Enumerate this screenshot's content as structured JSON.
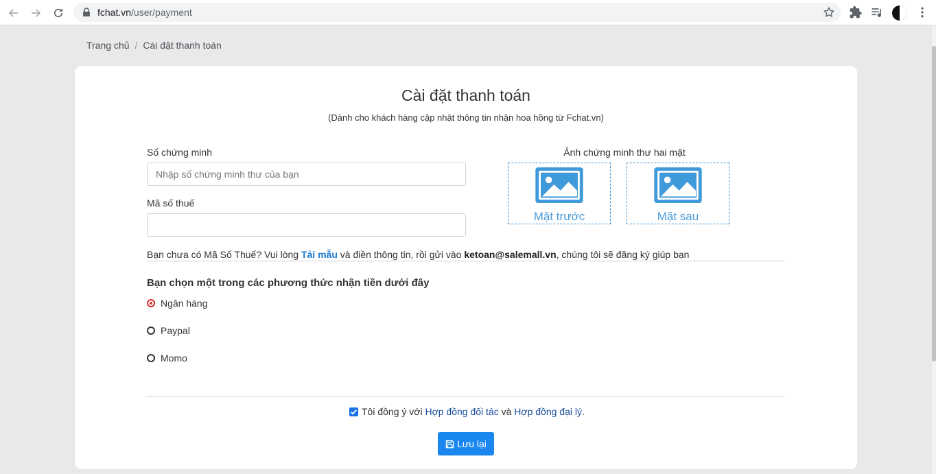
{
  "browser": {
    "url_host": "fchat.vn",
    "url_path": "/user/payment"
  },
  "breadcrumb": {
    "home": "Trang chủ",
    "separator": "/",
    "current": "Cài đặt thanh toán"
  },
  "page": {
    "title": "Cài đặt thanh toán",
    "subtitle": "(Dành cho khách hàng cập nhật thông tin nhận hoa hồng từ Fchat.vn)"
  },
  "form": {
    "id_number_label": "Số chứng minh",
    "id_number_placeholder": "Nhập số chứng minh thư của bạn",
    "id_number_value": "",
    "tax_code_label": "Mã số thuế",
    "tax_code_value": "",
    "id_photos_label": "Ảnh chứng minh thư hai mặt",
    "photo_front": "Mặt trước",
    "photo_back": "Mặt sau"
  },
  "note": {
    "prefix": "Bạn chưa có Mã Số Thuế? Vui lòng ",
    "link": "Tải mẫu",
    "middle": " và điền thông tin, rồi gửi vào ",
    "email": "ketoan@salemall.vn",
    "suffix": ", chúng tôi sẽ đăng ký giúp bạn"
  },
  "payment": {
    "title": "Bạn chọn một trong các phương thức nhận tiền dưới đây",
    "options": [
      {
        "label": "Ngân hàng",
        "checked": true
      },
      {
        "label": "Paypal",
        "checked": false
      },
      {
        "label": "Momo",
        "checked": false
      }
    ]
  },
  "agreement": {
    "checked": true,
    "prefix": "Tôi đồng ý với ",
    "link1": "Hợp đồng đối tác",
    "middle": " và ",
    "link2": "Hợp đồng đại lý",
    "suffix": "."
  },
  "actions": {
    "save_label": "Lưu lại"
  },
  "colors": {
    "primary": "#1a86f0",
    "radio_checked": "#d9302c",
    "link": "#1a7ad0"
  }
}
